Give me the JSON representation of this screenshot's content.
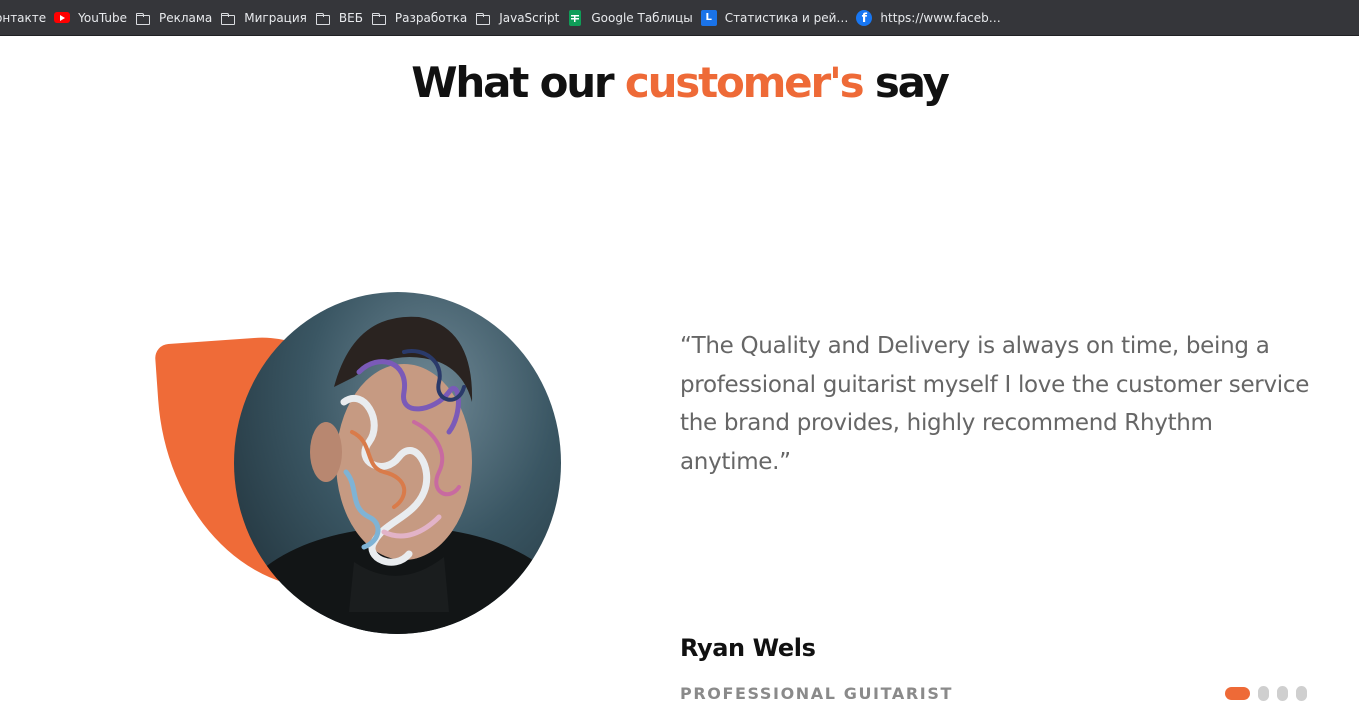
{
  "bookmarks": [
    {
      "label": "онтакте",
      "icon": "none"
    },
    {
      "label": "YouTube",
      "icon": "youtube-icon"
    },
    {
      "label": "Реклама",
      "icon": "folder-icon"
    },
    {
      "label": "Миграция",
      "icon": "folder-icon"
    },
    {
      "label": "ВЕБ",
      "icon": "folder-icon"
    },
    {
      "label": "Разработка",
      "icon": "folder-icon"
    },
    {
      "label": "JavaScript",
      "icon": "folder-icon"
    },
    {
      "label": "Google Таблицы",
      "icon": "google-sheets-icon"
    },
    {
      "label": "Статистика и рей…",
      "icon": "l-badge-icon"
    },
    {
      "label": "https://www.faceb…",
      "icon": "facebook-icon"
    }
  ],
  "section": {
    "title_part1": "What our",
    "title_accent": "customer's",
    "title_part2": "say"
  },
  "testimonial": {
    "quote": "“The Quality and Delivery is always on time, being a professional guitarist myself I love the customer service the brand provides, highly recommend Rhythm anytime.”",
    "author_name": "Ryan Wels",
    "author_role": "PROFESSIONAL GUITARIST"
  },
  "carousel": {
    "total": 4,
    "active": 1
  },
  "colors": {
    "accent": "#ee6a37",
    "heading": "#111111",
    "body_text": "#666666",
    "role_text": "#8a8a8a",
    "inactive_dot": "#cfcfcf"
  }
}
